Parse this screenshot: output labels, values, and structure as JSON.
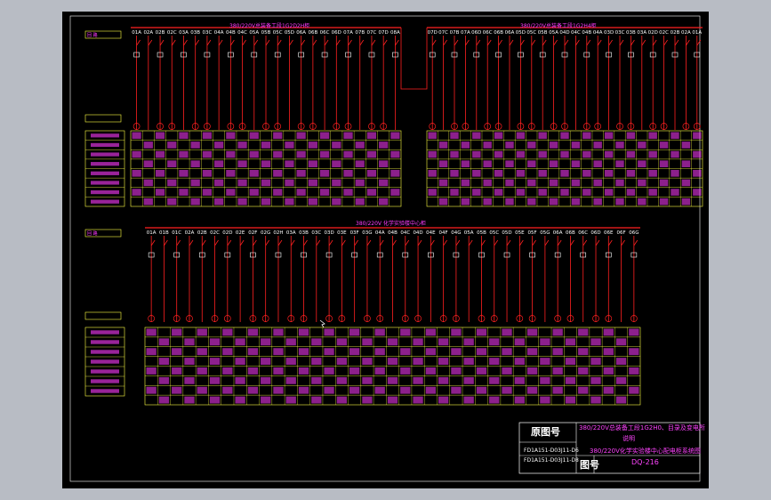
{
  "panels": {
    "top_left_title": "380/220V总装备工段1G2D2H柜",
    "top_right_title": "380/220V总装备工段1G2H4柜",
    "bottom_title": "380/220V 化学实验楼中心柜",
    "top_left_circuits": [
      "01A",
      "02A",
      "02B",
      "02C",
      "03A",
      "03B",
      "03C",
      "04A",
      "04B",
      "04C",
      "05A",
      "05B",
      "05C",
      "05D",
      "06A",
      "06B",
      "06C",
      "06D",
      "07A",
      "07B",
      "07C",
      "07D",
      "08A"
    ],
    "top_right_circuits": [
      "07D",
      "07C",
      "07B",
      "07A",
      "06D",
      "06C",
      "06B",
      "06A",
      "05D",
      "05C",
      "05B",
      "05A",
      "04D",
      "04C",
      "04B",
      "04A",
      "03D",
      "03C",
      "03B",
      "03A",
      "02D",
      "02C",
      "02B",
      "02A",
      "01A"
    ],
    "bottom_circuits": [
      "01A",
      "01B",
      "01C",
      "02A",
      "02B",
      "02C",
      "02D",
      "02E",
      "02F",
      "02G",
      "02H",
      "03A",
      "03B",
      "03C",
      "03D",
      "03E",
      "03F",
      "03G",
      "04A",
      "04B",
      "04C",
      "04D",
      "04E",
      "04F",
      "04G",
      "05A",
      "05B",
      "05C",
      "05D",
      "05E",
      "05F",
      "05G",
      "06A",
      "06B",
      "06C",
      "06D",
      "06E",
      "06F",
      "06G"
    ]
  },
  "row_labels": {
    "circuit_no": "回  路",
    "capacity": "负荷容量(kW)",
    "use": "用电设备",
    "work_current": "工作电流(A)",
    "cable": "电缆规格",
    "install": "安装方式",
    "kvs": "KVS编号",
    "loads": "负荷名称"
  },
  "title_block": {
    "orig_drawing_label": "原图号",
    "orig_no_1": "FD1A151-D03J11-D6",
    "orig_no_2": "FD1A151-D03J11-D8",
    "title_line1": "380/220V总装备工段1G2H0、目录及变电所",
    "title_line2": "说明",
    "title_line3": "380/220V化学实验楼中心配电柜系统图",
    "drawing_no_label": "图号",
    "drawing_no": "DQ-216"
  }
}
